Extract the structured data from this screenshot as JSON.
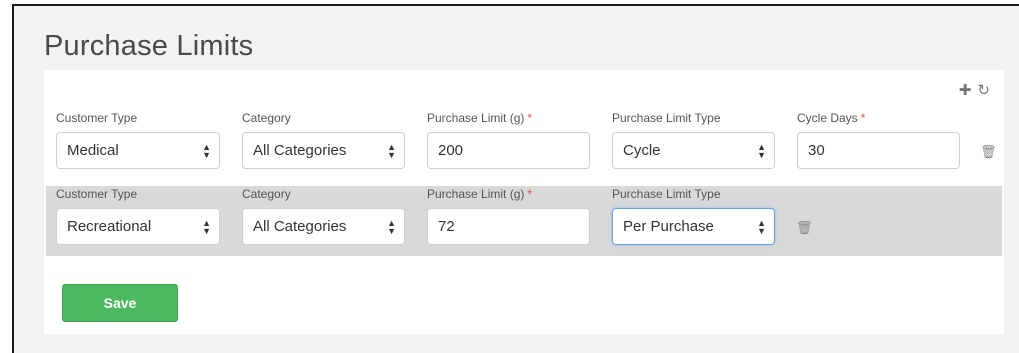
{
  "page": {
    "title": "Purchase Limits"
  },
  "toolbar": {
    "add_icon": "plus-icon",
    "refresh_icon": "refresh-icon"
  },
  "rows": [
    {
      "customer_type_label": "Customer Type",
      "customer_type_value": "Medical",
      "category_label": "Category",
      "category_value": "All Categories",
      "limit_label": "Purchase Limit (g)",
      "limit_value": "200",
      "limit_type_label": "Purchase Limit Type",
      "limit_type_value": "Cycle",
      "cycle_days_label": "Cycle Days",
      "cycle_days_value": "30"
    },
    {
      "customer_type_label": "Customer Type",
      "customer_type_value": "Recreational",
      "category_label": "Category",
      "category_value": "All Categories",
      "limit_label": "Purchase Limit (g)",
      "limit_value": "72",
      "limit_type_label": "Purchase Limit Type",
      "limit_type_value": "Per Purchase"
    }
  ],
  "required_mark": "*",
  "save_label": "Save",
  "colors": {
    "save": "#4cb960",
    "required": "#d9534f",
    "row_highlight": "#d9d9d9"
  }
}
